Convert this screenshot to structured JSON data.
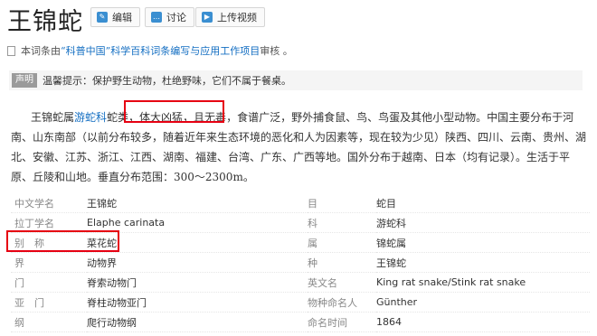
{
  "title": "王锦蛇",
  "toolbar": {
    "edit_label": "编辑",
    "discuss_label": "讨论",
    "upload_label": "上传视频"
  },
  "source": {
    "prefix": "本词条由",
    "org": "“科普中国”科学百科词条编写与应用工作项目",
    "suffix": " 审核 。"
  },
  "notice": {
    "tag": "声明",
    "text": "温馨提示：保护野生动物，杜绝野味，它们不属于餐桌。"
  },
  "intro": {
    "p1": "王锦蛇属",
    "link": "游蛇科",
    "p2": "蛇类，",
    "highlight": "体大凶猛，且无毒",
    "p3": "，食谱广泛，野外捕食鼠、鸟、鸟蛋及其他小型动物。中国主要分布于河南、山东南部（以前分布较多，随着近年来生态环境的恶化和人为因素等，现在较为少见）陕西、四川、云南、贵州、湖北、安徽、江苏、浙江、江西、湖南、福建、台湾、广东、广西等地。国外分布于越南、日本（均有记录）。生活于平原、丘陵和山地。垂直分布范围：300～2300m。"
  },
  "info_rows": [
    {
      "k1": "中文学名",
      "v1": "王锦蛇",
      "k2": "目",
      "v2": "蛇目"
    },
    {
      "k1": "拉丁学名",
      "v1": "Elaphe carinata",
      "k2": "科",
      "v2": "游蛇科"
    },
    {
      "k1": "别　称",
      "v1": "菜花蛇",
      "k2": "属",
      "v2": "锦蛇属"
    },
    {
      "k1": "界",
      "v1": "动物界",
      "k2": "种",
      "v2": "王锦蛇"
    },
    {
      "k1": "门",
      "v1": "脊索动物门",
      "k2": "英文名",
      "v2": "King rat snake/Stink rat snake"
    },
    {
      "k1": "亚　门",
      "v1": "脊柱动物亚门",
      "k2": "物种命名人",
      "v2": "Günther"
    },
    {
      "k1": "纲",
      "v1": "爬行动物纲",
      "k2": "命名时间",
      "v2": "1864"
    }
  ],
  "colors": {
    "link": "#136ec2",
    "icon_blue": "#3b8fd1",
    "highlight_box": "#e60012"
  },
  "icons": [
    "pencil-icon",
    "comment-icon",
    "play-icon",
    "document-icon"
  ]
}
